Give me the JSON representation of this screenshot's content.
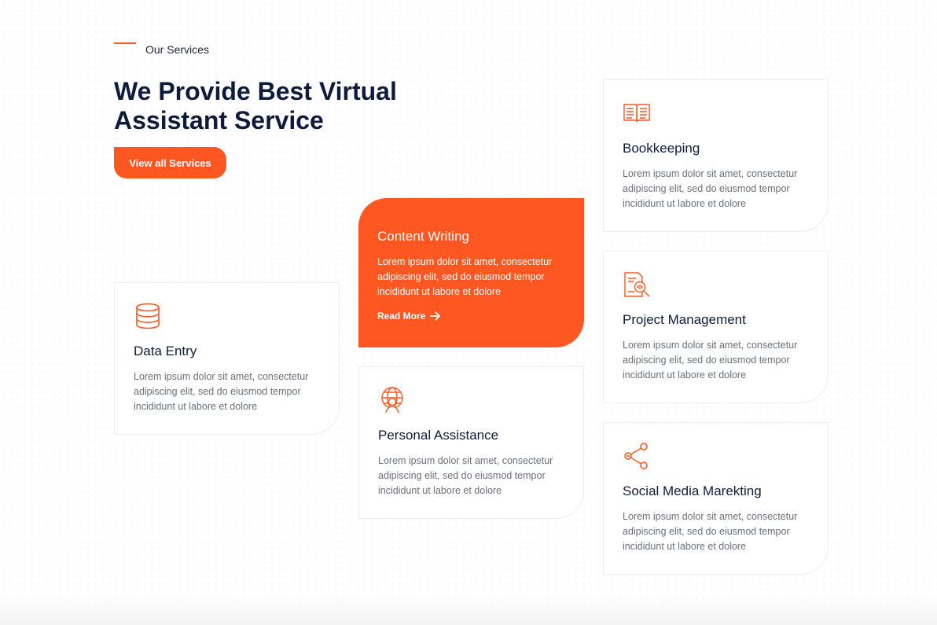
{
  "section": {
    "eyebrow": "Our Services",
    "headline": "We Provide Best Virtual Assistant Service",
    "cta_label": "View all Services"
  },
  "colors": {
    "accent": "#ff5722",
    "heading": "#0f1b3a",
    "body_text": "#6b6f78"
  },
  "services": [
    {
      "title": "Data Entry",
      "icon": "database-icon",
      "desc": "Lorem ipsum dolor sit amet, consectetur adipiscing elit, sed do eiusmod tempor incididunt ut labore et dolore"
    },
    {
      "title": "Content Writing",
      "desc": "Lorem ipsum dolor sit amet, consectetur adipiscing elit, sed do eiusmod tempor incididunt ut labore et dolore",
      "link": "Read More",
      "highlighted": true
    },
    {
      "title": "Personal Assistance",
      "icon": "globe-person-icon",
      "desc": "Lorem ipsum dolor sit amet, consectetur adipiscing elit, sed do eiusmod tempor incididunt ut labore et dolore"
    },
    {
      "title": "Bookkeeping",
      "icon": "open-book-icon",
      "desc": "Lorem ipsum dolor sit amet, consectetur adipiscing elit, sed do eiusmod tempor incididunt ut labore et dolore"
    },
    {
      "title": "Project Management",
      "icon": "document-search-icon",
      "desc": "Lorem ipsum dolor sit amet, consectetur adipiscing elit, sed do eiusmod tempor incididunt ut labore et dolore"
    },
    {
      "title": "Social Media Marekting",
      "icon": "share-icon",
      "desc": "Lorem ipsum dolor sit amet, consectetur adipiscing elit, sed do eiusmod tempor incididunt ut labore et dolore"
    }
  ]
}
